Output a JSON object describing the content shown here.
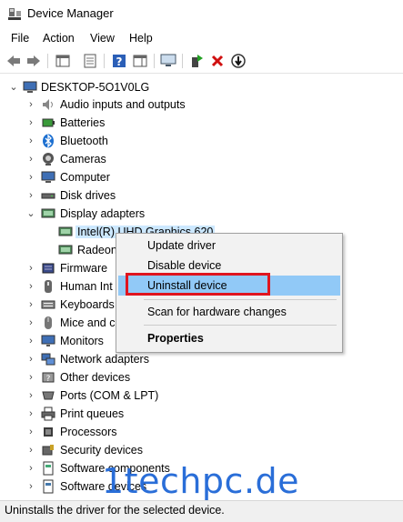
{
  "window": {
    "title": "Device Manager",
    "app_icon": "device-manager-icon"
  },
  "menu": [
    "File",
    "Action",
    "View",
    "Help"
  ],
  "toolbar": {
    "buttons": [
      "back-icon",
      "forward-icon",
      "show-hide-console-tree-icon",
      "properties-icon",
      "help-icon",
      "action-pane-icon",
      "monitor-icon",
      "update-driver-icon",
      "uninstall-icon",
      "scan-down-icon"
    ]
  },
  "tree": {
    "root": "DESKTOP-5O1V0LG",
    "items": [
      {
        "label": "Audio inputs and outputs",
        "icon": "speaker-icon"
      },
      {
        "label": "Batteries",
        "icon": "battery-icon"
      },
      {
        "label": "Bluetooth",
        "icon": "bluetooth-icon"
      },
      {
        "label": "Cameras",
        "icon": "camera-icon"
      },
      {
        "label": "Computer",
        "icon": "computer-icon"
      },
      {
        "label": "Disk drives",
        "icon": "disk-drive-icon"
      },
      {
        "label": "Display adapters",
        "icon": "display-adapter-icon"
      },
      {
        "label": "Intel(R) UHD Graphics 620",
        "icon": "display-adapter-icon"
      },
      {
        "label": "Radeon",
        "icon": "display-adapter-icon"
      },
      {
        "label": "Firmware",
        "icon": "firmware-icon"
      },
      {
        "label": "Human Int",
        "icon": "hid-icon"
      },
      {
        "label": "Keyboards",
        "icon": "keyboard-icon"
      },
      {
        "label": "Mice and c",
        "icon": "mouse-icon"
      },
      {
        "label": "Monitors",
        "icon": "monitor-icon"
      },
      {
        "label": "Network adapters",
        "icon": "network-icon"
      },
      {
        "label": "Other devices",
        "icon": "other-devices-icon"
      },
      {
        "label": "Ports (COM & LPT)",
        "icon": "port-icon"
      },
      {
        "label": "Print queues",
        "icon": "printer-icon"
      },
      {
        "label": "Processors",
        "icon": "processor-icon"
      },
      {
        "label": "Security devices",
        "icon": "security-icon"
      },
      {
        "label": "Software components",
        "icon": "software-component-icon"
      },
      {
        "label": "Software devices",
        "icon": "software-device-icon"
      }
    ]
  },
  "context_menu": {
    "items": [
      "Update driver",
      "Disable device",
      "Uninstall device",
      "Scan for hardware changes",
      "Properties"
    ]
  },
  "status": "Uninstalls the driver for the selected device.",
  "watermark": "1techpc.de",
  "colors": {
    "highlight": "#91c9f7",
    "selection": "#cce8ff",
    "red_box": "#e0151f",
    "watermark": "#2a6ed8"
  }
}
